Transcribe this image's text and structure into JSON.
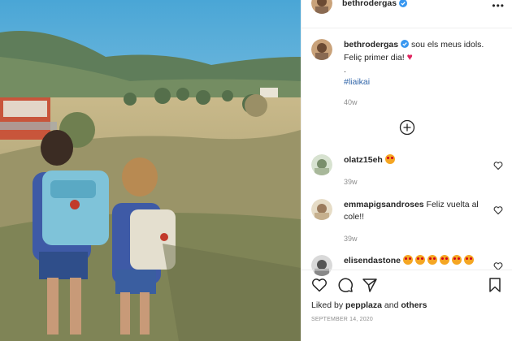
{
  "header": {
    "username": "bethrodergas",
    "verified_icon": "verified-badge-icon",
    "more_icon": "more-options-icon",
    "more_glyph": "•••"
  },
  "caption": {
    "username": "bethrodergas",
    "text_line1": "sou els meus idols.",
    "text_line2": "Feliç primer dia!",
    "heart_glyph": "♥",
    "dot": ".",
    "hashtag": "#liaikai",
    "time": "40w"
  },
  "load_more_icon": "plus-circle-icon",
  "comments": [
    {
      "username": "olatz15eh",
      "text": "",
      "emoji_count": 1,
      "time": "39w"
    },
    {
      "username": "emmapigsandroses",
      "text": "Feliz vuelta al cole!!",
      "emoji_count": 0,
      "time": "39w"
    },
    {
      "username": "elisendastone",
      "text": "",
      "emoji_count": 6,
      "time": ""
    }
  ],
  "actions": {
    "like_icon": "heart-icon",
    "comment_icon": "comment-icon",
    "share_icon": "share-icon",
    "save_icon": "bookmark-icon"
  },
  "liked_by": {
    "prefix": "Liked by",
    "user": "pepplaza",
    "conj": "and",
    "others": "others"
  },
  "date": "SEPTEMBER 14, 2020",
  "colors": {
    "text": "#262626",
    "muted": "#8e8e8e",
    "link": "#2f64a8",
    "verified": "#3897f0",
    "heart": "#e0245e"
  }
}
